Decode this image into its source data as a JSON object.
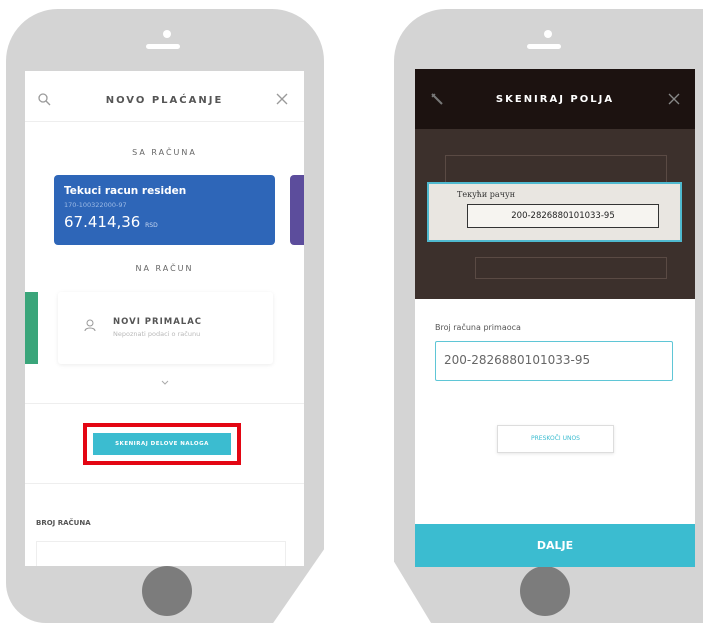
{
  "phone1": {
    "header": {
      "title": "NOVO PLAĆANJE"
    },
    "from_section": {
      "label": "SA RAČUNA"
    },
    "account_card": {
      "name": "Tekuci racun residen",
      "number": "170-100322000-97",
      "balance": "67.414,36",
      "currency": "RSD"
    },
    "to_section": {
      "label": "NA RAČUN"
    },
    "recipient": {
      "title": "NOVI PRIMALAC",
      "subtitle": "Nepoznati podaci o računu"
    },
    "scan_button": {
      "label": "SKENIRAJ DELOVE NALOGA"
    },
    "account_field": {
      "label": "BROJ RAČUNA"
    },
    "colors": {
      "card": "#2e66b8",
      "accent_green": "#3aa57a",
      "side_card": "#5c4d9c",
      "scan_button": "#3bbcd0",
      "highlight": "#e30613"
    }
  },
  "phone2": {
    "header": {
      "title": "SKENIRAJ POLJA"
    },
    "scan_doc": {
      "field_label": "Текући рачун",
      "field_value": "200-2826880101033-95"
    },
    "field": {
      "label": "Broj računa primaoca",
      "value": "200-2826880101033-95"
    },
    "skip_button": {
      "label": "PRESKOČI UNOS"
    },
    "next_button": {
      "label": "DALJE"
    },
    "colors": {
      "header": "#1c1210",
      "button": "#3bbcd0",
      "input_border": "#5fc6d6"
    }
  }
}
